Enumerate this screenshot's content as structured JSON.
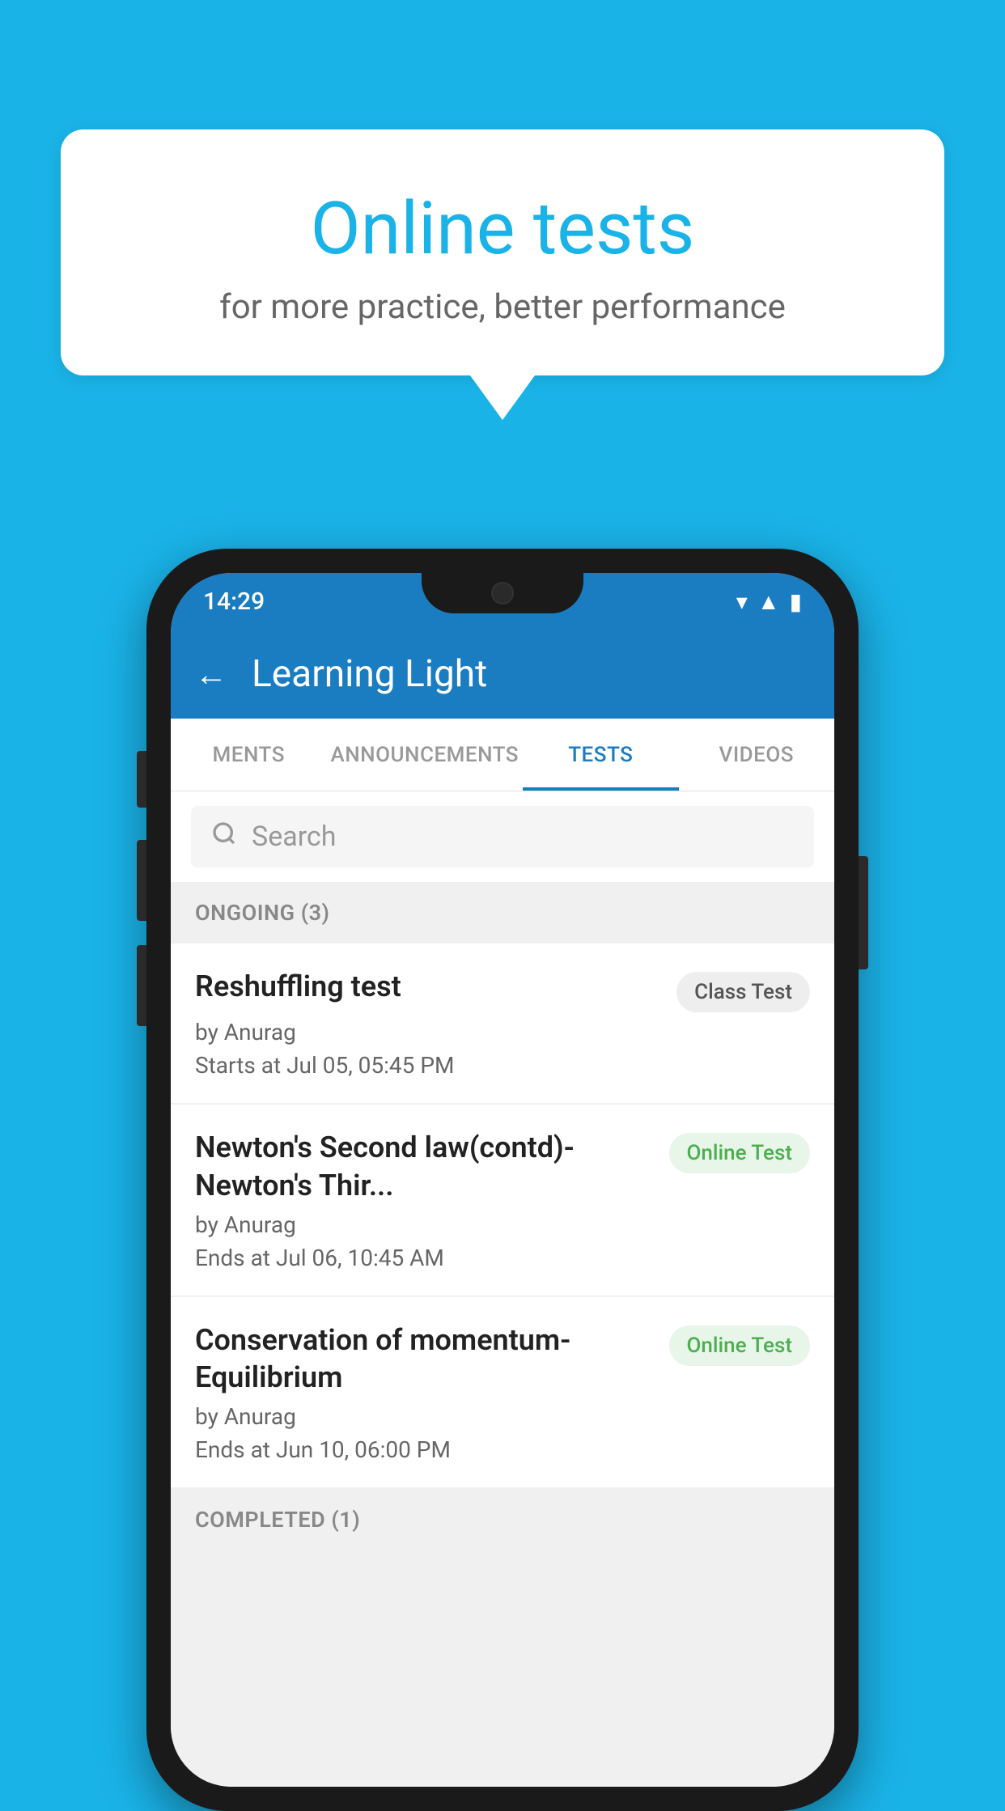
{
  "background": {
    "color": "#1ab3e8"
  },
  "speech_bubble": {
    "title": "Online tests",
    "subtitle": "for more practice, better performance"
  },
  "phone": {
    "status_bar": {
      "time": "14:29"
    },
    "app_bar": {
      "back_label": "←",
      "title": "Learning Light"
    },
    "tabs": [
      {
        "label": "MENTS",
        "active": false
      },
      {
        "label": "ANNOUNCEMENTS",
        "active": false
      },
      {
        "label": "TESTS",
        "active": true
      },
      {
        "label": "VIDEOS",
        "active": false
      }
    ],
    "search": {
      "placeholder": "Search"
    },
    "sections": [
      {
        "title": "ONGOING (3)",
        "tests": [
          {
            "title": "Reshuffling test",
            "author": "by Anurag",
            "date": "Starts at  Jul 05, 05:45 PM",
            "badge": "Class Test",
            "badge_type": "class"
          },
          {
            "title": "Newton's Second law(contd)-Newton's Thir...",
            "author": "by Anurag",
            "date": "Ends at  Jul 06, 10:45 AM",
            "badge": "Online Test",
            "badge_type": "online"
          },
          {
            "title": "Conservation of momentum-Equilibrium",
            "author": "by Anurag",
            "date": "Ends at  Jun 10, 06:00 PM",
            "badge": "Online Test",
            "badge_type": "online"
          }
        ]
      }
    ],
    "completed_section": {
      "title": "COMPLETED (1)"
    }
  }
}
